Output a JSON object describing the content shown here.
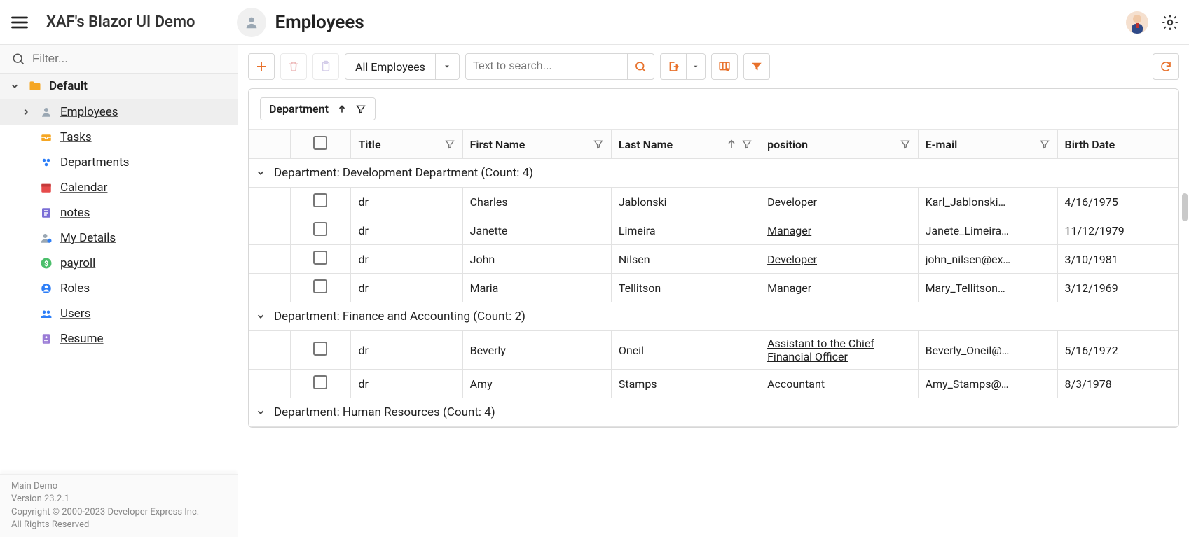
{
  "app_title": "XAF's Blazor UI Demo",
  "page": {
    "title": "Employees",
    "icon": "user-icon"
  },
  "sidebar": {
    "filter_placeholder": "Filter...",
    "root_label": "Default",
    "items": [
      {
        "id": "employees",
        "label": "Employees",
        "icon": "user-icon",
        "active": true,
        "expandable": true
      },
      {
        "id": "tasks",
        "label": "Tasks",
        "icon": "inbox-icon"
      },
      {
        "id": "departments",
        "label": "Departments",
        "icon": "team-icon"
      },
      {
        "id": "calendar",
        "label": "Calendar",
        "icon": "calendar-icon"
      },
      {
        "id": "notes",
        "label": "notes",
        "icon": "notes-icon"
      },
      {
        "id": "mydetails",
        "label": "My Details",
        "icon": "userinfo-icon"
      },
      {
        "id": "payroll",
        "label": "payroll",
        "icon": "dollar-icon"
      },
      {
        "id": "roles",
        "label": "Roles",
        "icon": "roledot-icon"
      },
      {
        "id": "users",
        "label": "Users",
        "icon": "users-icon"
      },
      {
        "id": "resume",
        "label": "Resume",
        "icon": "resume-icon"
      }
    ]
  },
  "footer": {
    "line1": "Main Demo",
    "line2": "Version 23.2.1",
    "line3": "Copyright © 2000-2023 Developer Express Inc.",
    "line4": "All Rights Reserved"
  },
  "toolbar": {
    "view_label": "All Employees",
    "search_placeholder": "Text to search..."
  },
  "grid": {
    "group_by": "Department",
    "columns": [
      {
        "key": "title",
        "label": "Title"
      },
      {
        "key": "first",
        "label": "First Name"
      },
      {
        "key": "last",
        "label": "Last Name",
        "sort": "asc"
      },
      {
        "key": "position",
        "label": "position"
      },
      {
        "key": "email",
        "label": "E-mail"
      },
      {
        "key": "birth",
        "label": "Birth Date"
      }
    ],
    "groups": [
      {
        "header": "Department: Development Department (Count: 4)",
        "rows": [
          {
            "title": "dr",
            "first": "Charles",
            "last": "Jablonski",
            "position": "Developer",
            "email": "Karl_Jablonski…",
            "birth": "4/16/1975"
          },
          {
            "title": "dr",
            "first": "Janette",
            "last": "Limeira",
            "position": "Manager",
            "email": "Janete_Limeira…",
            "birth": "11/12/1979"
          },
          {
            "title": "dr",
            "first": "John",
            "last": "Nilsen",
            "position": "Developer",
            "email": "john_nilsen@ex…",
            "birth": "3/10/1981"
          },
          {
            "title": "dr",
            "first": "Maria",
            "last": "Tellitson",
            "position": "Manager",
            "email": "Mary_Tellitson…",
            "birth": "3/12/1969"
          }
        ]
      },
      {
        "header": "Department: Finance and Accounting (Count: 2)",
        "rows": [
          {
            "title": "dr",
            "first": "Beverly",
            "last": "Oneil",
            "position": "Assistant to the Chief Financial Officer",
            "email": "Beverly_Oneil@…",
            "birth": "5/16/1972"
          },
          {
            "title": "dr",
            "first": "Amy",
            "last": "Stamps",
            "position": "Accountant",
            "email": "Amy_Stamps@…",
            "birth": "8/3/1978"
          }
        ]
      },
      {
        "header": "Department: Human Resources (Count: 4)",
        "rows": []
      }
    ]
  }
}
